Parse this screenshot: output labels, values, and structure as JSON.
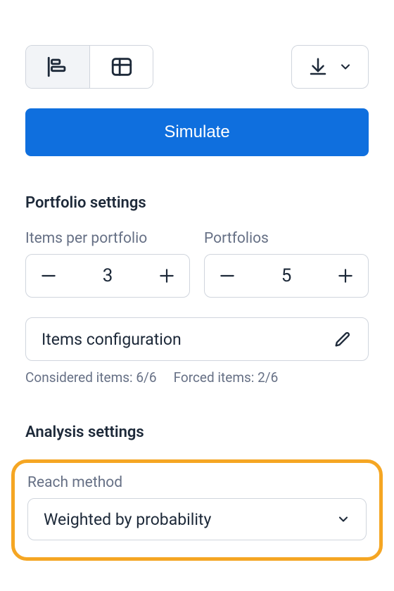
{
  "toolbar": {
    "view_toggle": {
      "chart_active": true,
      "table_active": false
    }
  },
  "actions": {
    "simulate_label": "Simulate"
  },
  "portfolio": {
    "header": "Portfolio settings",
    "items_per_portfolio": {
      "label": "Items per portfolio",
      "value": "3"
    },
    "portfolios": {
      "label": "Portfolios",
      "value": "5"
    },
    "items_config": {
      "label": "Items configuration",
      "considered": "Considered items: 6/6",
      "forced": "Forced items: 2/6"
    }
  },
  "analysis": {
    "header": "Analysis settings",
    "reach_method": {
      "label": "Reach method",
      "value": "Weighted by probability"
    }
  }
}
